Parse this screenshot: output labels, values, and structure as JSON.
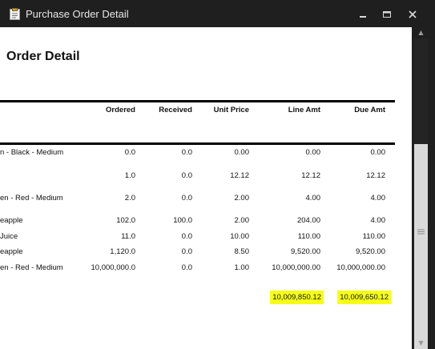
{
  "window": {
    "title": "Purchase Order Detail",
    "icon": "clipboard-icon",
    "controls": [
      "minimize-icon",
      "maximize-icon",
      "close-icon"
    ]
  },
  "report": {
    "heading": "Order Detail",
    "columns": [
      "Ordered",
      "Received",
      "Unit Price",
      "Line Amt",
      "Due Amt"
    ],
    "rows": [
      {
        "item": "n - Black - Medium",
        "ordered": "0.0",
        "received": "0.0",
        "unit_price": "0.00",
        "line_amt": "0.00",
        "due_amt": "0.00"
      },
      {
        "item": "",
        "ordered": "1.0",
        "received": "0.0",
        "unit_price": "12.12",
        "line_amt": "12.12",
        "due_amt": "12.12"
      },
      {
        "item": "en - Red - Medium",
        "ordered": "2.0",
        "received": "0.0",
        "unit_price": "2.00",
        "line_amt": "4.00",
        "due_amt": "4.00"
      },
      {
        "item": "eapple",
        "ordered": "102.0",
        "received": "100.0",
        "unit_price": "2.00",
        "line_amt": "204.00",
        "due_amt": "4.00"
      },
      {
        "item": "Juice",
        "ordered": "11.0",
        "received": "0.0",
        "unit_price": "10.00",
        "line_amt": "110.00",
        "due_amt": "110.00"
      },
      {
        "item": "eapple",
        "ordered": "1,120.0",
        "received": "0.0",
        "unit_price": "8.50",
        "line_amt": "9,520.00",
        "due_amt": "9,520.00"
      },
      {
        "item": "en - Red - Medium",
        "ordered": "10,000,000.0",
        "received": "0.0",
        "unit_price": "1.00",
        "line_amt": "10,000,000.00",
        "due_amt": "10,000,000.00"
      }
    ],
    "totals": {
      "line_amt": "10,009,850.12",
      "due_amt": "10,009,650.12"
    },
    "highlight_color": "#f6ff17"
  }
}
